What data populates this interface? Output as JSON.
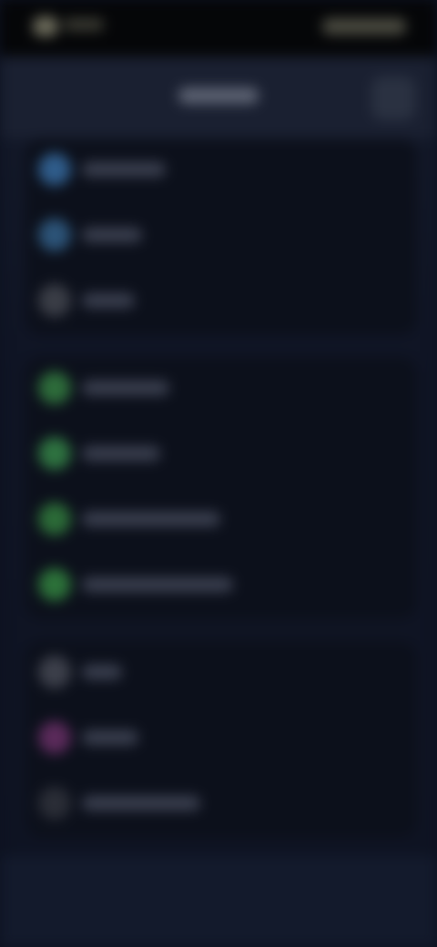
{
  "status_bar": {
    "left_indicator": "",
    "right_indicators": ""
  },
  "header": {
    "title": "",
    "action_icon": "menu-icon"
  },
  "groups": [
    {
      "items": [
        {
          "label": "",
          "icon": "blue-icon",
          "color": "#2f5c8a"
        },
        {
          "label": "",
          "icon": "blue-icon",
          "color": "#2c5377"
        },
        {
          "label": "",
          "icon": "gray-icon",
          "color": "#3a3d46"
        }
      ]
    },
    {
      "items": [
        {
          "label": "",
          "icon": "green-icon",
          "color": "#2d6b3a"
        },
        {
          "label": "",
          "icon": "green-icon",
          "color": "#2e7240"
        },
        {
          "label": "",
          "icon": "green-icon",
          "color": "#2b6a37"
        },
        {
          "label": "",
          "icon": "green-icon",
          "color": "#2c7139"
        }
      ]
    },
    {
      "items": [
        {
          "label": "",
          "icon": "gray-icon",
          "color": "#3c3f4a"
        },
        {
          "label": "",
          "icon": "purple-icon",
          "color": "#5a2a5a"
        },
        {
          "label": "",
          "icon": "dark-icon",
          "color": "#2a2d36"
        }
      ]
    }
  ]
}
